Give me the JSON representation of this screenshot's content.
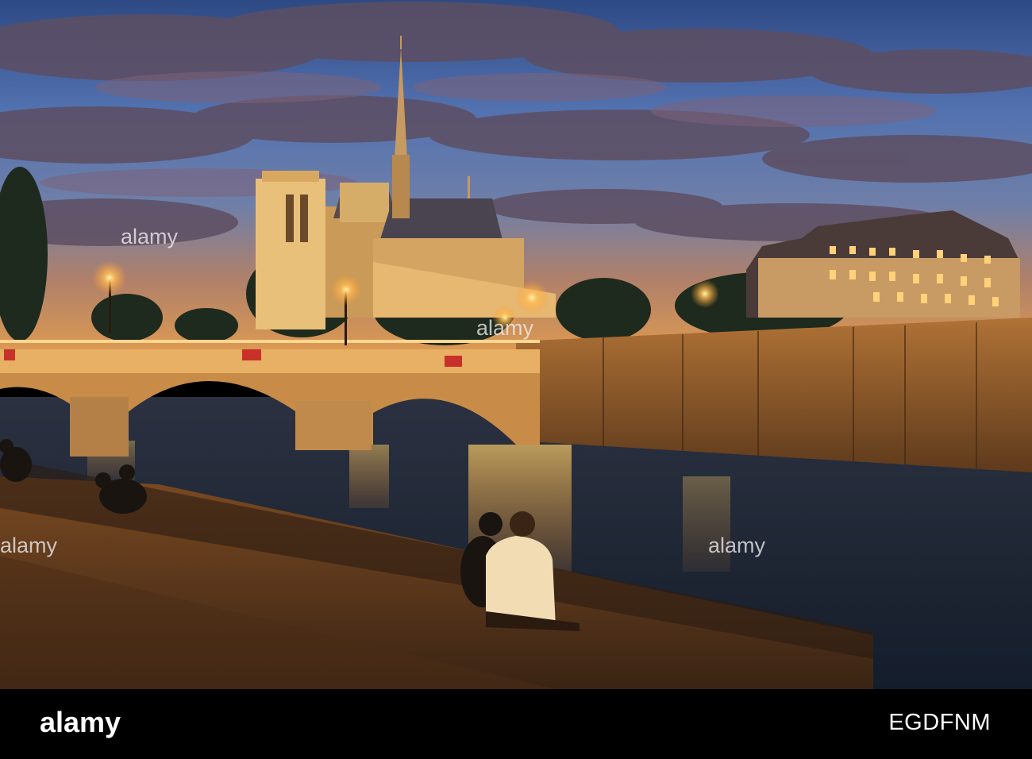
{
  "watermark_text": "alamy",
  "footer": {
    "logo_text": "alamy",
    "image_id": "EGDFNM"
  },
  "colors": {
    "sky_top": "#3f5f9c",
    "sky_dusk": "#f0a04a",
    "river": "#1c2a3c",
    "lamp_glow": "#ffb347",
    "stone_wall": "#8a5a2c"
  }
}
